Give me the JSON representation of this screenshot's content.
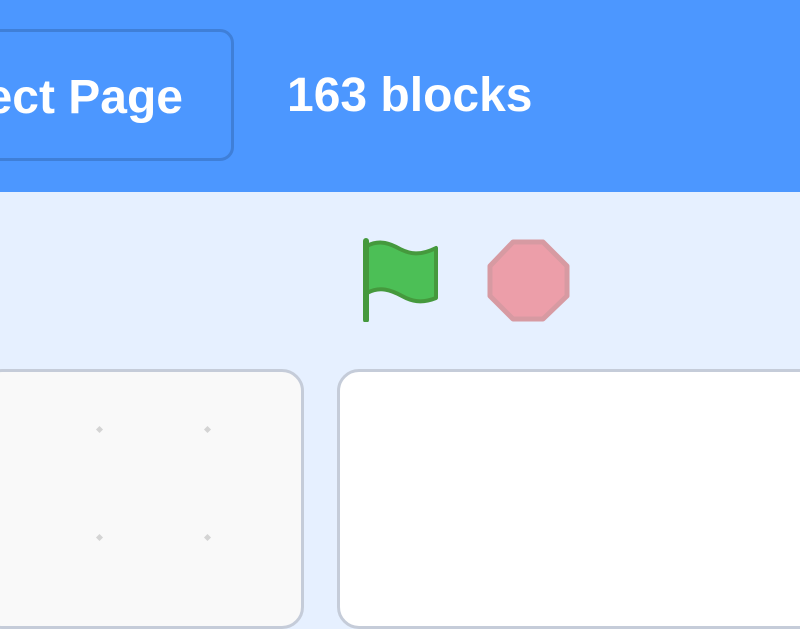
{
  "header": {
    "project_page_label": "ect Page",
    "block_count": "163 blocks"
  },
  "controls": {
    "green_flag_icon": "green-flag-icon",
    "stop_icon": "stop-sign-icon"
  },
  "colors": {
    "header_bg": "#4c97ff",
    "page_bg": "#e6f0ff",
    "flag_green": "#4cbf56",
    "stop_red": "#ec9ea9"
  }
}
